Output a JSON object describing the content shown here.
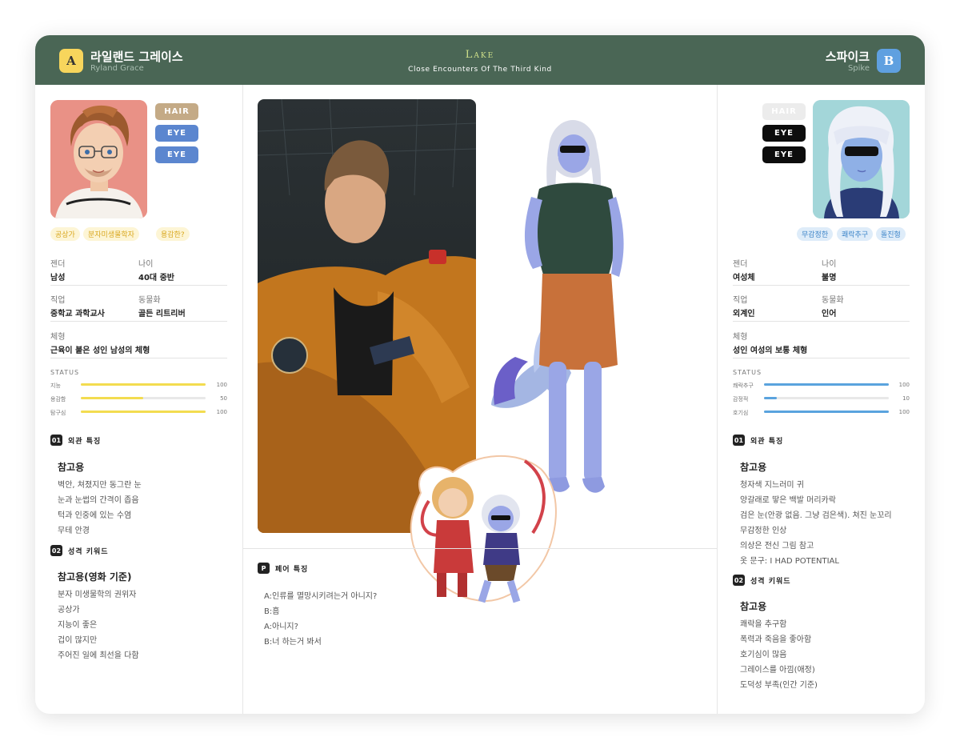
{
  "header": {
    "title": "Lake",
    "subtitle": "Close Encounters Of The Third Kind",
    "left": {
      "badge": "A",
      "name": "라일랜드 그레이스",
      "name_en": "Ryland Grace"
    },
    "right": {
      "badge": "B",
      "name": "스파이크",
      "name_en": "Spike"
    }
  },
  "left": {
    "chips": [
      "HAIR",
      "EYE",
      "EYE"
    ],
    "tags": [
      "공상가",
      "분자미생물학자",
      "용감한?"
    ],
    "fields": [
      {
        "label": "젠더",
        "value": "남성"
      },
      {
        "label": "나이",
        "value": "40대 중반"
      },
      {
        "label": "직업",
        "value": "중학교 과학교사"
      },
      {
        "label": "동물화",
        "value": "골든 리트리버"
      },
      {
        "label": "체형",
        "value": "근육이 붙은 성인 남성의 체형"
      }
    ],
    "status_title": "STATUS",
    "stats": [
      {
        "label": "지능",
        "value": 100,
        "display": "100"
      },
      {
        "label": "용감함",
        "value": 50,
        "display": "50"
      },
      {
        "label": "탐구심",
        "value": 100,
        "display": "100"
      }
    ],
    "sections": [
      {
        "num": "01",
        "title": "외관 특징",
        "heading": "참고용",
        "items": [
          "벽안, 쳐졌지만 동그란 눈",
          "눈과 눈썹의 간격이 좁음",
          "턱과 인중에 있는 수염",
          "무테 안경"
        ]
      },
      {
        "num": "02",
        "title": "성격 키워드",
        "heading": "참고용(영화 기준)",
        "items": [
          "분자 미생물학의 권위자",
          "공상가",
          "지능이 좋은",
          "겁이 많지만",
          "주어진 일에 최선을 다함"
        ]
      }
    ]
  },
  "right": {
    "chips": [
      "HAIR",
      "EYE",
      "EYE"
    ],
    "tags": [
      "무감정한",
      "쾌락추구",
      "돌진형"
    ],
    "fields": [
      {
        "label": "젠더",
        "value": "여성체"
      },
      {
        "label": "나이",
        "value": "불명"
      },
      {
        "label": "직업",
        "value": "외계인"
      },
      {
        "label": "동물화",
        "value": "인어"
      },
      {
        "label": "체형",
        "value": "성인 여성의 보통 체형"
      }
    ],
    "status_title": "STATUS",
    "stats": [
      {
        "label": "쾌락추구",
        "value": 100,
        "display": "100"
      },
      {
        "label": "감정적",
        "value": 10,
        "display": "10"
      },
      {
        "label": "호기심",
        "value": 100,
        "display": "100"
      }
    ],
    "sections": [
      {
        "num": "01",
        "title": "외관 특징",
        "heading": "참고용",
        "items": [
          "청자색 지느러미 귀",
          "양갈래로 땋은 백발 머리카락",
          "검은 눈(안광 없음. 그냥 검은색). 쳐진 눈꼬리",
          "무감정한 인상",
          "의상은 전신 그림 참고",
          "옷 문구: I HAD POTENTIAL"
        ]
      },
      {
        "num": "02",
        "title": "성격 키워드",
        "heading": "참고용",
        "items": [
          "쾌락을 추구함",
          "폭력과 죽음을 좋아함",
          "호기심이 많음",
          "그레이스를 아낌(애정)",
          "도덕성 부족(인간 기준)"
        ]
      }
    ]
  },
  "pair": {
    "num": "P",
    "title": "페어 특징",
    "lines": [
      "A:인류를 멸망시키려는거 아니지?",
      "B:흠",
      "A:아니지?",
      "B:너 하는거 봐서"
    ]
  },
  "colors": {
    "header_bg": "#4a6655",
    "badge_a": "#f7d55c",
    "badge_b": "#5fa0e0",
    "hair_left": "#c4aa86",
    "eye_left": "#5b86cf",
    "hair_right": "#ececec",
    "eye_right": "#0d0d0d",
    "stat_left": "#f3dc50",
    "stat_right": "#5aa3de"
  },
  "icons": [
    "portrait-grace",
    "portrait-spike",
    "photo-astronaut",
    "spike-fullbody-drawing",
    "chibi-sticker"
  ]
}
